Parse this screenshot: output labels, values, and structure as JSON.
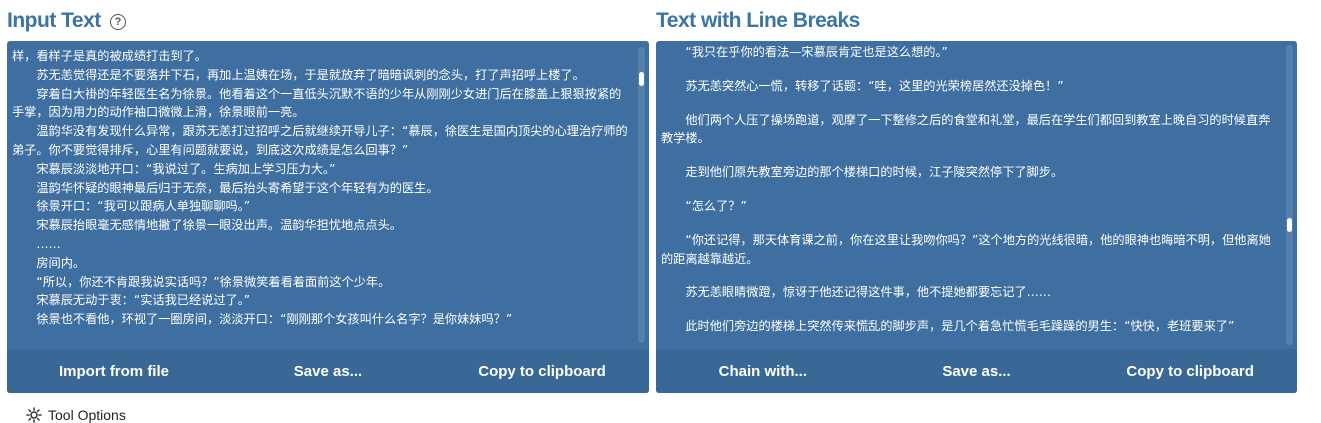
{
  "input_panel": {
    "title": "Input Text",
    "help_icon": "?",
    "lines": [
      "样，看样子是真的被成绩打击到了。",
      "　　苏无恙觉得还是不要落井下石，再加上温姨在场，于是就放弃了暗暗讽刺的念头，打了声招呼上楼了。",
      "　　穿着白大褂的年轻医生名为徐景。他看着这个一直低头沉默不语的少年从刚刚少女进门后在膝盖上狠狠按紧的手掌，因为用力的动作袖口微微上滑，徐景眼前一亮。",
      "　　温韵华没有发现什么异常，跟苏无恙打过招呼之后就继续开导儿子：“慕辰，徐医生是国内顶尖的心理治疗师的弟子。你不要觉得排斥，心里有问题就要说，到底这次成绩是怎么回事？”",
      "　　宋慕辰淡淡地开口：“我说过了。生病加上学习压力大。”",
      "　　温韵华怀疑的眼神最后归于无奈，最后抬头寄希望于这个年轻有为的医生。",
      "　　徐景开口：“我可以跟病人单独聊聊吗。”",
      "　　宋慕辰抬眼毫无感情地撇了徐景一眼没出声。温韵华担忧地点点头。",
      "　　……",
      "　　房间内。",
      "　　“所以，你还不肯跟我说实话吗？”徐景微笑着看着面前这个少年。",
      "　　宋慕辰无动于衷：“实话我已经说过了。”",
      "　　徐景也不看他，环视了一圈房间，淡淡开口：“刚刚那个女孩叫什么名字？是你妹妹吗？”"
    ],
    "buttons": [
      "Import from file",
      "Save as...",
      "Copy to clipboard"
    ]
  },
  "output_panel": {
    "title": "Text with Line Breaks",
    "lines": [
      "　　“我只在乎你的看法—宋慕辰肯定也是这么想的。”",
      "　　苏无恙突然心一慌，转移了话题：“哇，这里的光荣榜居然还没掉色！”",
      "　　他们两个人压了操场跑道，观摩了一下整修之后的食堂和礼堂，最后在学生们都回到教室上晚自习的时候直奔教学楼。",
      "　　走到他们原先教室旁边的那个楼梯口的时候，江子陵突然停下了脚步。",
      "　　“怎么了？”",
      "　　“你还记得，那天体育课之前，你在这里让我吻你吗？”这个地方的光线很暗，他的眼神也晦暗不明，但他离她的距离越靠越近。",
      "　　苏无恙眼睛微蹬，惊讶于他还记得这件事，他不提她都要忘记了……",
      "　　此时他们旁边的楼梯上突然传来慌乱的脚步声，是几个着急忙慌毛毛躁躁的男生：“快快，老班要来了”"
    ],
    "buttons": [
      "Chain with...",
      "Save as...",
      "Copy to clipboard"
    ]
  },
  "tool_options": {
    "label": "Tool Options",
    "icon": "gear-icon"
  },
  "colors": {
    "accent_title": "#3c74a5",
    "panel_bg": "#3e6fa0",
    "footer_bg": "#3a6896"
  }
}
